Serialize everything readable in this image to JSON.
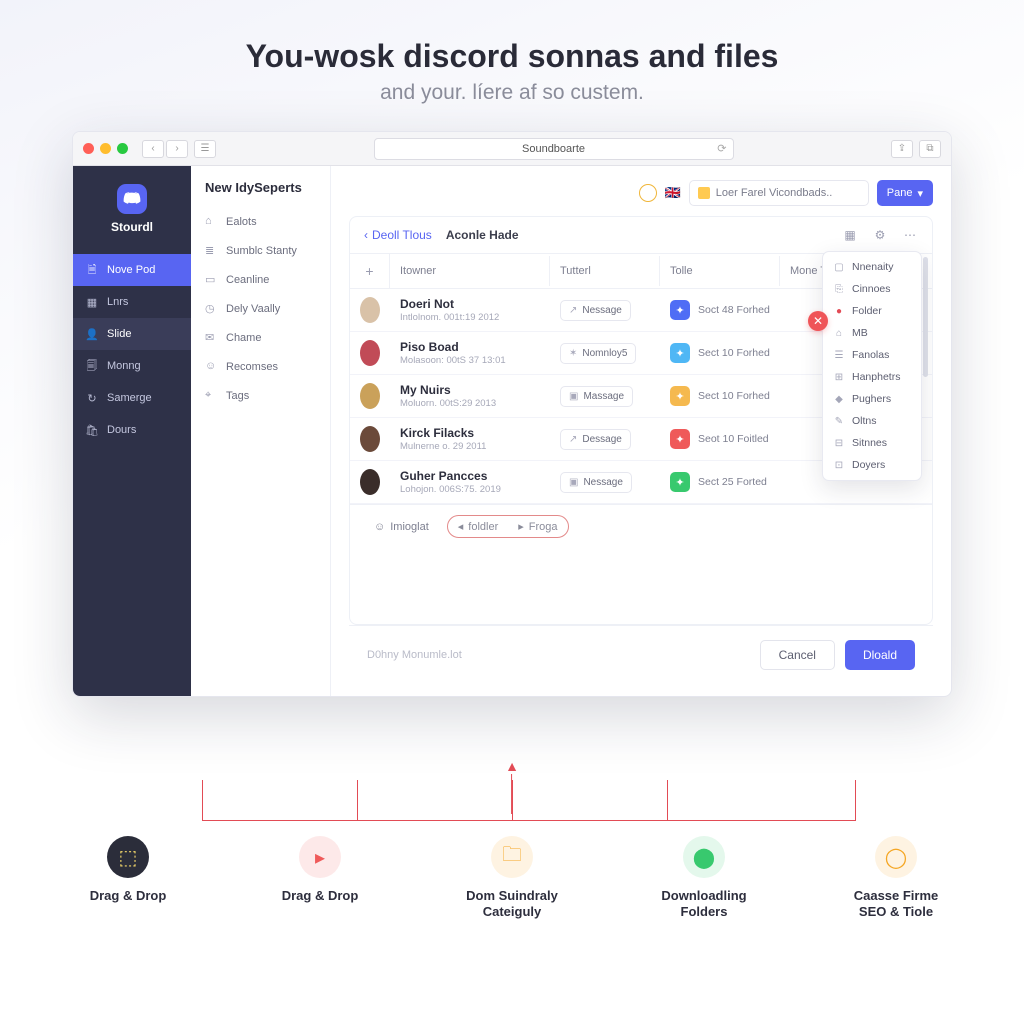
{
  "hero": {
    "title": "You-wosk discord sonnas and files",
    "subtitle": "and your. líere af so custem."
  },
  "window": {
    "address": "Soundboarte"
  },
  "brand": {
    "name": "Stourdl"
  },
  "nav": [
    {
      "icon": "file",
      "label": "Nove Pod",
      "state": "active"
    },
    {
      "icon": "grid",
      "label": "Lnrs",
      "state": ""
    },
    {
      "icon": "user",
      "label": "Slide",
      "state": "alt"
    },
    {
      "icon": "doc",
      "label": "Monng",
      "state": ""
    },
    {
      "icon": "sync",
      "label": "Samerge",
      "state": ""
    },
    {
      "icon": "bag",
      "label": "Dours",
      "state": ""
    }
  ],
  "sub": {
    "title": "New IdySeperts",
    "items": [
      {
        "icon": "home",
        "label": "Ealots"
      },
      {
        "icon": "layers",
        "label": "Sumblc Stanty"
      },
      {
        "icon": "cal",
        "label": "Ceanline"
      },
      {
        "icon": "clock",
        "label": "Dely Vaally"
      },
      {
        "icon": "chat",
        "label": "Chame"
      },
      {
        "icon": "person",
        "label": "Recomses"
      },
      {
        "icon": "tag",
        "label": "Tags"
      }
    ]
  },
  "topbar": {
    "search": "Loer Farel Vicondbads..",
    "primary": "Pane"
  },
  "breadcrumb": {
    "back": "Deoll Tlous",
    "current": "Aconle Hade"
  },
  "columns": {
    "c1": "Itowner",
    "c2": "Tutterl",
    "c3": "Tolle",
    "c4": "Mone Tatle"
  },
  "rows": [
    {
      "av": "#d9c2a8",
      "name": "Doeri Not",
      "meta": "Intlolnom. 001t:19 2012",
      "pill": "Nessage",
      "pi": "↗",
      "sq": "#4f6df5",
      "sect": "Soct 48  Forhed"
    },
    {
      "av": "#c14b57",
      "name": "Piso Boad",
      "meta": "Molasoon: 00tS 37  13:01",
      "pill": "Nomnloy5",
      "pi": "✶",
      "sq": "#4fb7f5",
      "sect": "Sect 10  Forhed"
    },
    {
      "av": "#caa15a",
      "name": "My Nuirs",
      "meta": "Moluorn. 00tS:29 2013",
      "pill": "Massage",
      "pi": "▣",
      "sq": "#f5b94f",
      "sect": "Sect 10  Forhed"
    },
    {
      "av": "#6b4a3a",
      "name": "Kirck Filacks",
      "meta": "Mulnerne o. 29 2011",
      "pill": "Dessage",
      "pi": "↗",
      "sq": "#ef5a5a",
      "sect": "Seot 10  Foitled"
    },
    {
      "av": "#3a2d2a",
      "name": "Guher Pancces",
      "meta": "Lohojon. 006S:75. 2019",
      "pill": "Nessage",
      "pi": "▣",
      "sq": "#38c96e",
      "sect": "Sect 25  Forted"
    }
  ],
  "dropdown": [
    {
      "icon": "▢",
      "label": "Nnenaity"
    },
    {
      "icon": "⎘",
      "label": "Cinnoes"
    },
    {
      "icon": "●",
      "label": "Folder",
      "red": true
    },
    {
      "icon": "⌂",
      "label": "MB"
    },
    {
      "icon": "☰",
      "label": "Fanolas"
    },
    {
      "icon": "⊞",
      "label": "Hanphetrs"
    },
    {
      "icon": "◆",
      "label": "Pughers"
    },
    {
      "icon": "✎",
      "label": "Oltns"
    },
    {
      "icon": "⊟",
      "label": "Sitnnes"
    },
    {
      "icon": "⊡",
      "label": "Doyers"
    }
  ],
  "cardFooter": {
    "a": "Imioglat",
    "b": "foldler",
    "c": "Froga"
  },
  "footer": {
    "hint": "D0hny Monumle.lot",
    "cancel": "Cancel",
    "ok": "Dloald"
  },
  "features": [
    {
      "color": "#2b2d3a",
      "glyph": "⬚",
      "line1": "Drag & Drop",
      "line2": ""
    },
    {
      "color": "#ef5a5a",
      "glyph": "▸",
      "line1": "Drag & Drop",
      "line2": ""
    },
    {
      "color": "#f5a623",
      "glyph": "🗀",
      "line1": "Dom Suindraly",
      "line2": "Cateiguly"
    },
    {
      "color": "#38c96e",
      "glyph": "⬤",
      "line1": "Downloadling",
      "line2": "Folders"
    },
    {
      "color": "#f5a623",
      "glyph": "◯",
      "line1": "Caasse Firme",
      "line2": "SEO & Tiole"
    }
  ]
}
